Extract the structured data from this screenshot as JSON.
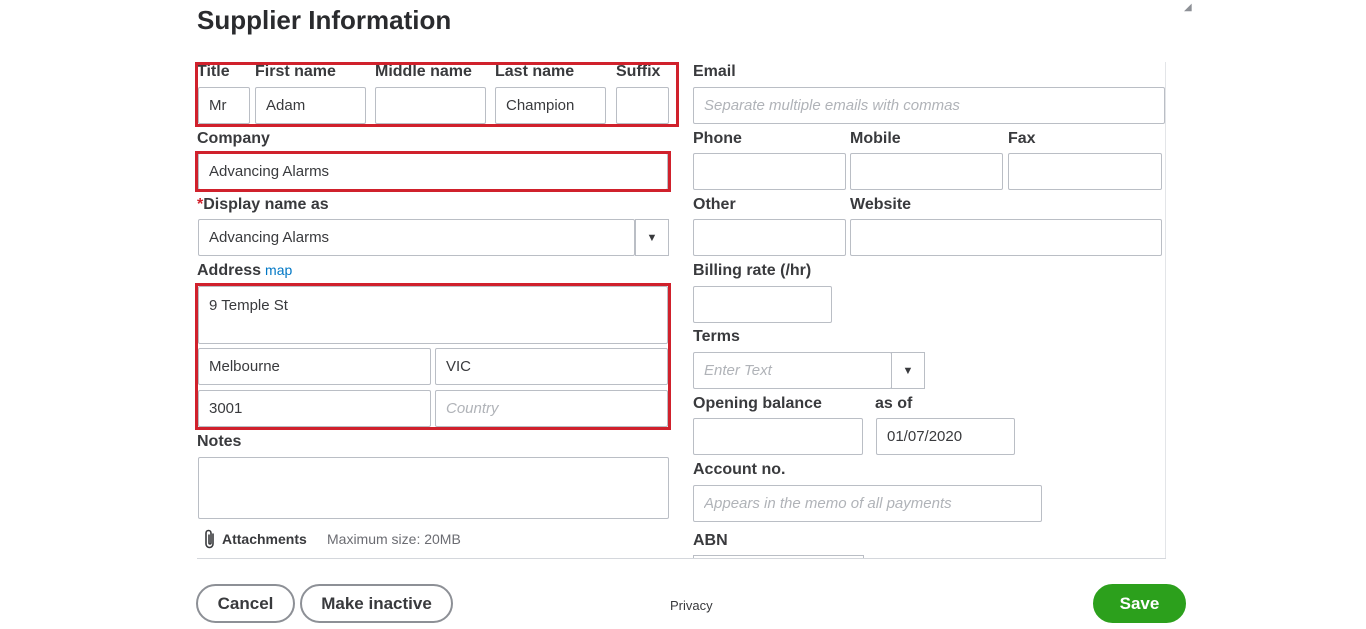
{
  "page_title": "Supplier Information",
  "name": {
    "title_label": "Title",
    "title_value": "Mr",
    "first_label": "First name",
    "first_value": "Adam",
    "middle_label": "Middle name",
    "middle_value": "",
    "last_label": "Last name",
    "last_value": "Champion",
    "suffix_label": "Suffix",
    "suffix_value": ""
  },
  "company": {
    "label": "Company",
    "value": "Advancing Alarms"
  },
  "display_name": {
    "required_mark": "*",
    "label": "Display name as",
    "value": "Advancing Alarms"
  },
  "address": {
    "label": "Address",
    "map_link": "map",
    "street": "9 Temple St",
    "city": "Melbourne",
    "state": "VIC",
    "postcode": "3001",
    "country_placeholder": "Country"
  },
  "notes": {
    "label": "Notes",
    "value": ""
  },
  "attachments": {
    "label": "Attachments",
    "max_size": "Maximum size: 20MB",
    "icon": "paperclip-icon"
  },
  "email": {
    "label": "Email",
    "placeholder": "Separate multiple emails with commas"
  },
  "phone": {
    "label": "Phone",
    "value": ""
  },
  "mobile": {
    "label": "Mobile",
    "value": ""
  },
  "fax": {
    "label": "Fax",
    "value": ""
  },
  "other": {
    "label": "Other",
    "value": ""
  },
  "website": {
    "label": "Website",
    "value": ""
  },
  "billing_rate": {
    "label": "Billing rate (/hr)",
    "value": ""
  },
  "terms": {
    "label": "Terms",
    "placeholder": "Enter Text"
  },
  "opening_balance": {
    "label": "Opening balance",
    "value": "",
    "as_of_label": "as of",
    "as_of_value": "01/07/2020"
  },
  "account_no": {
    "label": "Account no.",
    "placeholder": "Appears in the memo of all payments"
  },
  "abn": {
    "label": "ABN"
  },
  "footer": {
    "cancel": "Cancel",
    "make_inactive": "Make inactive",
    "privacy": "Privacy",
    "save": "Save"
  },
  "colors": {
    "highlight_red": "#d0212c",
    "save_green": "#2ca01c",
    "link_blue": "#0077c5"
  }
}
